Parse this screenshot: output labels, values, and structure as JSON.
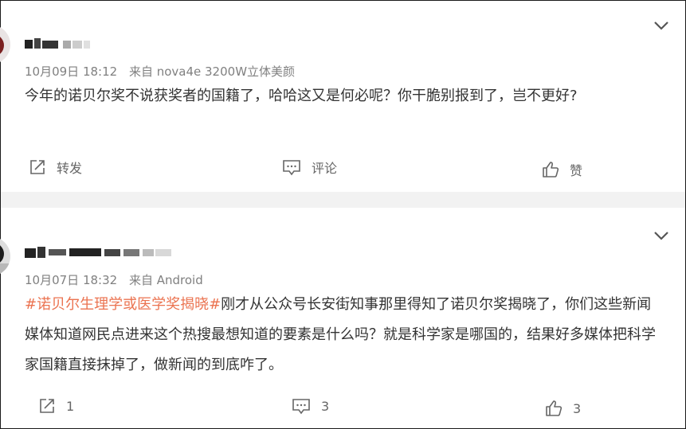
{
  "comments": [
    {
      "timestamp": "10月09日 18:12",
      "source": "来自 nova4e 3200W立体美颜",
      "text": "今年的诺贝尔奖不说获奖者的国籍了，哈哈这又是何必呢？你干脆别报到了，岂不更好?",
      "actions": {
        "repost": "转发",
        "comment": "评论",
        "like": "赞"
      }
    },
    {
      "timestamp": "10月07日 18:32",
      "source": "来自 Android",
      "topic": "#诺贝尔生理学或医学奖揭晓#",
      "text": "刚才从公众号长安街知事那里得知了诺贝尔奖揭晓了，你们这些新闻媒体知道网民点进来这个热搜最想知道的要素是什么吗？就是科学家是哪国的，结果好多媒体把科学家国籍直接抹掉了，做新闻的到底咋了。",
      "actions": {
        "repost": "1",
        "comment": "3",
        "like": "3"
      }
    }
  ],
  "icons": [
    "chevron-down-icon",
    "repost-icon",
    "comment-icon",
    "like-icon"
  ],
  "colors": {
    "topic": "#eb7350",
    "meta": "#808080",
    "text": "#333333",
    "divider_gap": "#f2f2f2"
  }
}
